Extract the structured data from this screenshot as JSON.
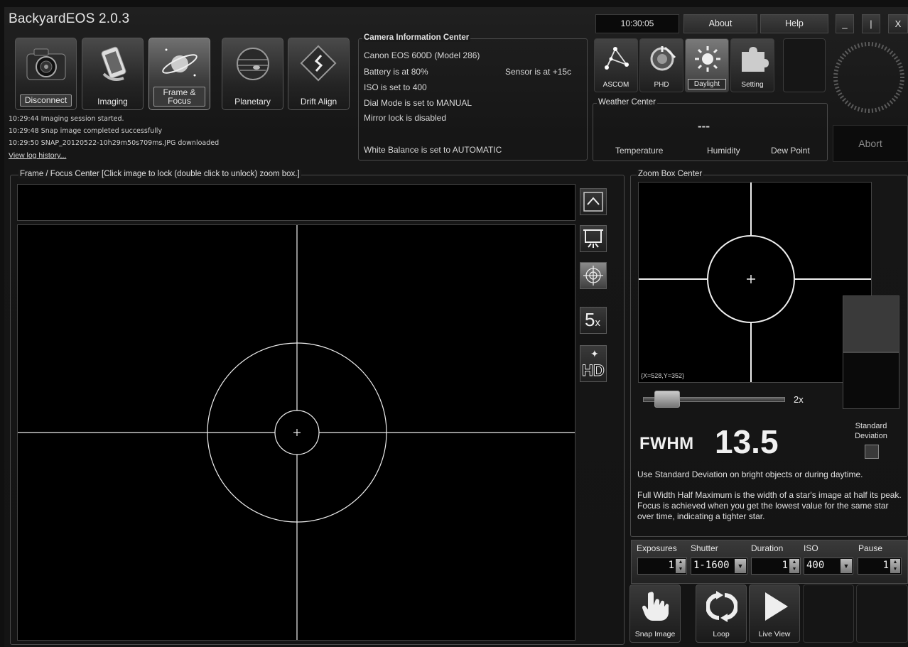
{
  "app": {
    "title": "BackyardEOS 2.0.3"
  },
  "modes": [
    {
      "label": "Disconnect",
      "icon": "camera-icon"
    },
    {
      "label": "Imaging",
      "icon": "film-icon"
    },
    {
      "label": "Frame & Focus",
      "icon": "planet-icon"
    },
    {
      "label": "Planetary",
      "icon": "jupiter-icon"
    },
    {
      "label": "Drift Align",
      "icon": "drift-icon"
    }
  ],
  "log": {
    "lines": [
      "10:29:44  Imaging session started.",
      "10:29:48  Snap image completed successfully",
      "10:29:50  SNAP_20120522-10h29m50s709ms.JPG downloaded"
    ],
    "history_link": "View log history..."
  },
  "camera_info": {
    "title": "Camera Information Center",
    "model": "Canon EOS 600D   (Model 286)",
    "battery": "Battery is at 80%",
    "sensor": "Sensor is at +15c",
    "iso": "ISO is set to 400",
    "dial_mode": "Dial Mode is set to MANUAL",
    "mirror_lock": "Mirror lock is disabled",
    "white_balance": "White Balance is set to AUTOMATIC"
  },
  "topbar": {
    "clock": "10:30:05",
    "about": "About",
    "help": "Help",
    "minimize": "_",
    "restore": "|",
    "close": "X"
  },
  "tools": [
    {
      "label": "ASCOM",
      "icon": "ascom-icon"
    },
    {
      "label": "PHD",
      "icon": "phd-icon"
    },
    {
      "label": "Daylight",
      "icon": "sun-icon"
    },
    {
      "label": "Setting",
      "icon": "puzzle-icon"
    }
  ],
  "weather": {
    "title": "Weather Center",
    "value": "---",
    "temperature": "Temperature",
    "humidity": "Humidity",
    "dew_point": "Dew Point"
  },
  "abort": "Abort",
  "frame_focus": {
    "title": "Frame / Focus Center   [Click image to lock (double click to unlock) zoom box.]",
    "side_buttons": [
      "collapse-up-icon",
      "projector-icon",
      "target-icon",
      "zoom-5x-icon",
      "hd-icon"
    ],
    "zoom_5x": "5",
    "zoom_5x_suffix": "x",
    "hd": "HD"
  },
  "zoom_box": {
    "title": "Zoom Box Center",
    "coords": "{X=528,Y=352}",
    "zoom_label": "2x",
    "zoom_level": 0.1
  },
  "fwhm": {
    "label": "FWHM",
    "value": "13.5",
    "std_dev_label": "Standard Deviation",
    "std_dev_checked": false,
    "hint": "Use Standard Deviation on bright objects or during daytime.",
    "description": "Full Width Half Maximum is the width of a star's image at half its peak.  Focus is achieved when you get the lowest value for the same star over time, indicating a tighter star."
  },
  "exposure": {
    "headers": [
      "Exposures",
      "Shutter",
      "Duration",
      "ISO",
      "Pause"
    ],
    "exposures": "1",
    "shutter": "1-1600",
    "duration": "1",
    "iso": "400",
    "pause": "1"
  },
  "actions": [
    {
      "label": "Snap Image",
      "icon": "hand-icon"
    },
    {
      "label": "Loop",
      "icon": "loop-icon"
    },
    {
      "label": "Live View",
      "icon": "play-icon"
    }
  ]
}
